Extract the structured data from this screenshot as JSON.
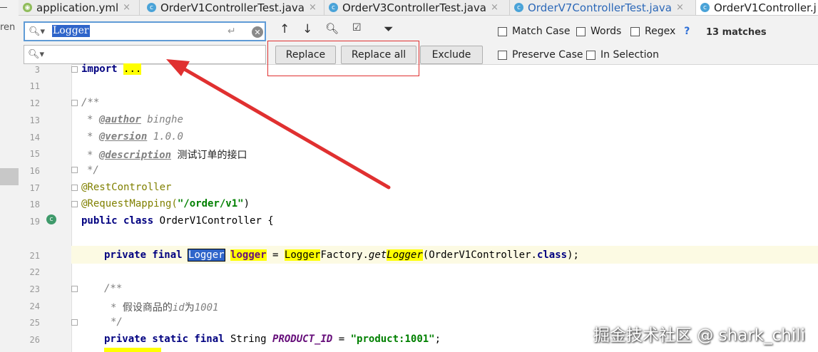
{
  "tabs": [
    {
      "label": "application.yml",
      "close": "×",
      "icon": "yml-file-icon",
      "active": false
    },
    {
      "label": "OrderV1ControllerTest.java",
      "close": "×",
      "icon": "class-icon",
      "active": false
    },
    {
      "label": "OrderV3ControllerTest.java",
      "close": "×",
      "icon": "class-icon",
      "active": false
    },
    {
      "label": "OrderV7ControllerTest.java",
      "close": "×",
      "icon": "class-icon",
      "active": false
    },
    {
      "label": "OrderV1Controller.j",
      "icon": "class-icon",
      "active": true
    }
  ],
  "sidebar": {
    "partial_text": "ren"
  },
  "find": {
    "search_value": "Logger",
    "replace_value": "",
    "replace_label": "Replace",
    "replace_all_label": "Replace all",
    "exclude_label": "Exclude",
    "match_case_label": "Match Case",
    "words_label": "Words",
    "regex_label": "Regex",
    "help_label": "?",
    "preserve_case_label": "Preserve Case",
    "in_selection_label": "In Selection",
    "matches_text": "13 matches"
  },
  "editor": {
    "line_numbers": [
      "3",
      "11",
      "12",
      "13",
      "14",
      "15",
      "16",
      "17",
      "18",
      "19",
      "21",
      "22",
      "23",
      "24",
      "25",
      "26"
    ],
    "lines": {
      "l3_kw": "import",
      "l3_fold": "...",
      "l12": "/**",
      "l13_star": "* ",
      "l13_tag": "@author",
      "l13_text": " binghe",
      "l14_star": "* ",
      "l14_tag": "@version",
      "l14_text": " 1.0.0",
      "l15_star": "* ",
      "l15_tag": "@description",
      "l15_text": " 测试订单的接口",
      "l16": "*/",
      "l17": "@RestController",
      "l18_ann": "@RequestMapping(",
      "l18_str": "\"/order/v1\"",
      "l18_end": ")",
      "l19_kw": "public class",
      "l19_text": " OrderV1Controller {",
      "l21_kw": "private final",
      "l21_sel": "Logger",
      "l21_var": "logger",
      "l21_eq": " = ",
      "l21_hl": "Logger",
      "l21_factory": "Factory.",
      "l21_method1": "get",
      "l21_method2": "Logger",
      "l21_args": "(OrderV1Controller.",
      "l21_class": "class",
      "l21_end": ");",
      "l23": "/**",
      "l24_star": "* ",
      "l24_text": "假设商品的",
      "l24_id": "id",
      "l24_text2": "为",
      "l24_num": "1001",
      "l25": "*/",
      "l26_kw": "private static final",
      "l26_type": " String ",
      "l26_const": "PRODUCT_ID",
      "l26_eq": " = ",
      "l26_str": "\"product:1001\"",
      "l26_end": ";"
    }
  },
  "watermark": "掘金技术社区 @ shark_chili",
  "colors": {
    "selection": "#2f65ca",
    "highlight": "#ffff00",
    "annotation_red": "#e03030",
    "current_line": "#fcfae3"
  }
}
